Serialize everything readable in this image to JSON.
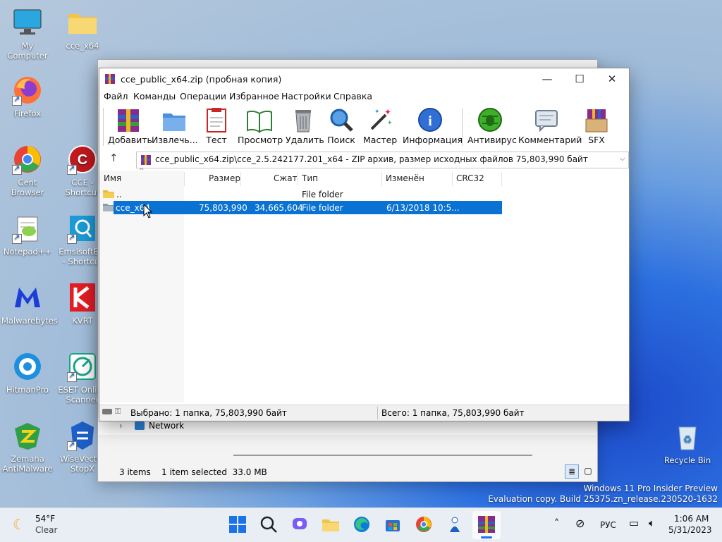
{
  "desktop": {
    "icons": [
      {
        "label": "My Computer",
        "icon": "monitor-icon"
      },
      {
        "label": "cce_x64",
        "icon": "folder-icon"
      },
      {
        "label": "Firefox",
        "icon": "firefox-icon"
      },
      {
        "label": "Cent Browser",
        "icon": "centbrowser-icon"
      },
      {
        "label": "CCE - Shortcut",
        "icon": "cce-icon"
      },
      {
        "label": "Notepad++",
        "icon": "notepadpp-icon"
      },
      {
        "label": "EmsisoftEm - Shortcut",
        "icon": "emsisoft-icon"
      },
      {
        "label": "Malwarebytes",
        "icon": "malwarebytes-icon"
      },
      {
        "label": "KVRT",
        "icon": "kvrt-icon"
      },
      {
        "label": "HitmanPro",
        "icon": "hitmanpro-icon"
      },
      {
        "label": "ESET Online Scanner",
        "icon": "eset-icon"
      },
      {
        "label": "Zemana AntiMalware",
        "icon": "zemana-icon"
      },
      {
        "label": "WiseVector StopX",
        "icon": "wisevector-icon"
      },
      {
        "label": "Recycle Bin",
        "icon": "recycle-bin-icon"
      }
    ],
    "watermark_line1": "Windows 11 Pro Insider Preview",
    "watermark_line2": "Evaluation copy. Build 25375.zn_release.230520-1632"
  },
  "explorer": {
    "nav_item": "Network",
    "status_items": "3 items",
    "status_selected": "1 item selected  33.0 MB"
  },
  "winrar": {
    "title": "cce_public_x64.zip (пробная копия)",
    "menu": [
      "Файл",
      "Команды",
      "Операции",
      "Избранное",
      "Настройки",
      "Справка"
    ],
    "toolbar": [
      {
        "label": "Добавить",
        "icon": "add-archive-icon"
      },
      {
        "label": "Извлечь...",
        "icon": "extract-folder-icon"
      },
      {
        "label": "Тест",
        "icon": "test-clipboard-icon"
      },
      {
        "label": "Просмотр",
        "icon": "view-book-icon"
      },
      {
        "label": "Удалить",
        "icon": "trash-icon"
      },
      {
        "label": "Поиск",
        "icon": "magnifier-icon"
      },
      {
        "label": "Мастер",
        "icon": "wizard-wand-icon"
      },
      {
        "label": "Информация",
        "icon": "info-icon"
      },
      {
        "label": "Антивирус",
        "icon": "antivirus-bug-icon"
      },
      {
        "label": "Комментарий",
        "icon": "comment-icon"
      },
      {
        "label": "SFX",
        "icon": "sfx-box-icon"
      }
    ],
    "address": "cce_public_x64.zip\\cce_2.5.242177.201_x64 - ZIP архив, размер исходных файлов 75,803,990 байт",
    "columns": [
      "Имя",
      "Размер",
      "Сжат",
      "Тип",
      "Изменён",
      "CRC32"
    ],
    "rows": [
      {
        "name": "..",
        "size": "",
        "packed": "",
        "type": "File folder",
        "modified": "",
        "crc": ""
      },
      {
        "name": "cce_x64",
        "size": "75,803,990",
        "packed": "34,665,604",
        "type": "File folder",
        "modified": "6/13/2018 10:5...",
        "crc": ""
      }
    ],
    "status_left": "Выбрано: 1 папка, 75,803,990 байт",
    "status_right": "Всего: 1 папка, 75,803,990 байт"
  },
  "taskbar": {
    "weather_temp": "54°F",
    "weather_desc": "Clear",
    "lang": "РУС",
    "time": "1:06 AM",
    "date": "5/31/2023"
  },
  "colors": {
    "selection": "#0a72d2",
    "accent": "#1a5fd6"
  }
}
